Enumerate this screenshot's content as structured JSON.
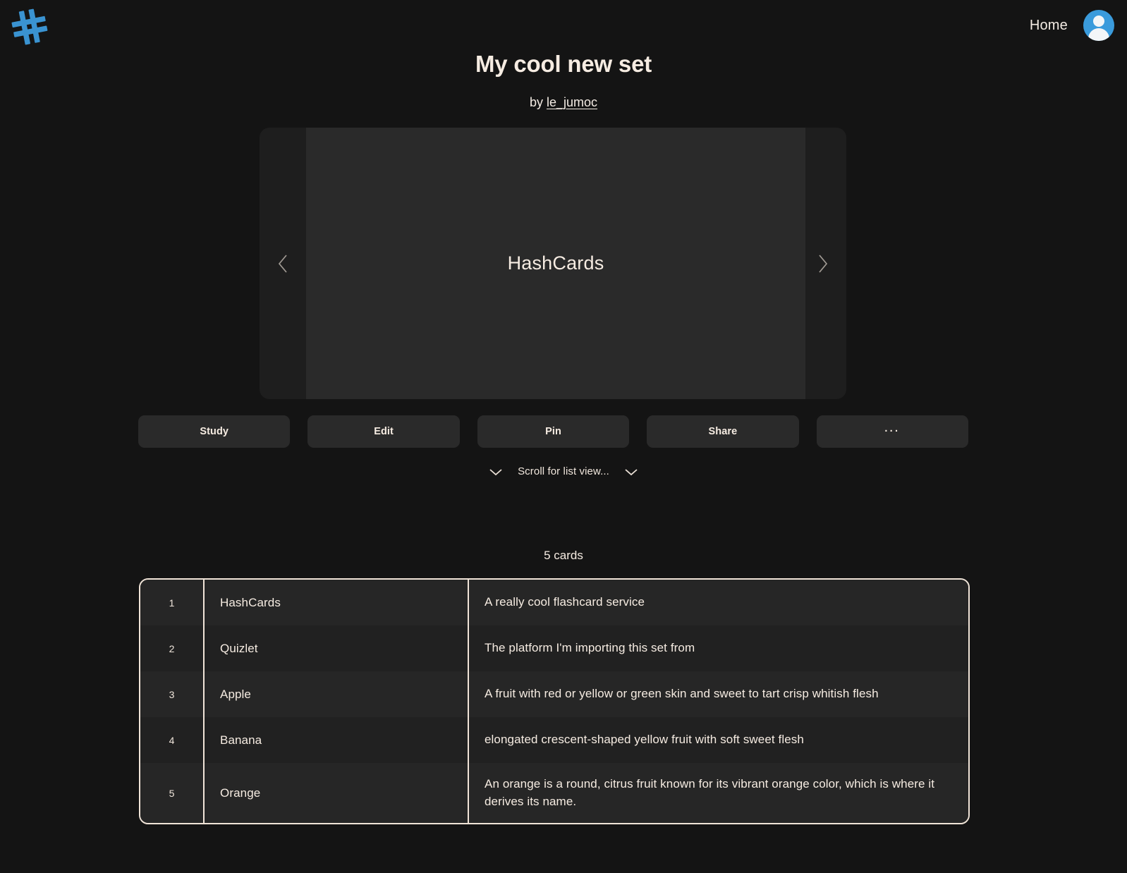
{
  "topbar": {
    "logo_icon": "hashtag-logo-icon",
    "logo_color": "#3a93d1",
    "home_label": "Home",
    "avatar_icon": "user-avatar-icon",
    "avatar_color": "#3a9bdc"
  },
  "header": {
    "title": "My cool new set",
    "by_prefix": "by ",
    "author": "le_jumoc"
  },
  "carousel": {
    "current_card_text": "HashCards",
    "prev_icon": "chevron-left-icon",
    "next_icon": "chevron-right-icon"
  },
  "actions": [
    {
      "label": "Study",
      "name": "study-button"
    },
    {
      "label": "Edit",
      "name": "edit-button"
    },
    {
      "label": "Pin",
      "name": "pin-button"
    },
    {
      "label": "Share",
      "name": "share-button"
    },
    {
      "label": "···",
      "name": "more-options-button"
    }
  ],
  "scroll_hint": {
    "label": "Scroll for list view...",
    "left_icon": "chevron-down-icon",
    "right_icon": "chevron-down-icon"
  },
  "list": {
    "count_label": "5 cards",
    "rows": [
      {
        "index": "1",
        "term": "HashCards",
        "definition": "A really cool flashcard service"
      },
      {
        "index": "2",
        "term": "Quizlet",
        "definition": "The platform I'm importing this set from"
      },
      {
        "index": "3",
        "term": "Apple",
        "definition": "A fruit with red or yellow or green skin and sweet to tart crisp whitish flesh"
      },
      {
        "index": "4",
        "term": "Banana",
        "definition": "elongated crescent-shaped yellow fruit with soft sweet flesh"
      },
      {
        "index": "5",
        "term": "Orange",
        "definition": "An orange is a round, citrus fruit known for its vibrant orange color, which is where it derives its name."
      }
    ]
  },
  "colors": {
    "page_background": "#141414",
    "panel": "#2a2a2a",
    "card_shell": "#1e1e1e",
    "text": "#f6ece2",
    "border": "#f0e4d8",
    "accent": "#3a93d1"
  }
}
